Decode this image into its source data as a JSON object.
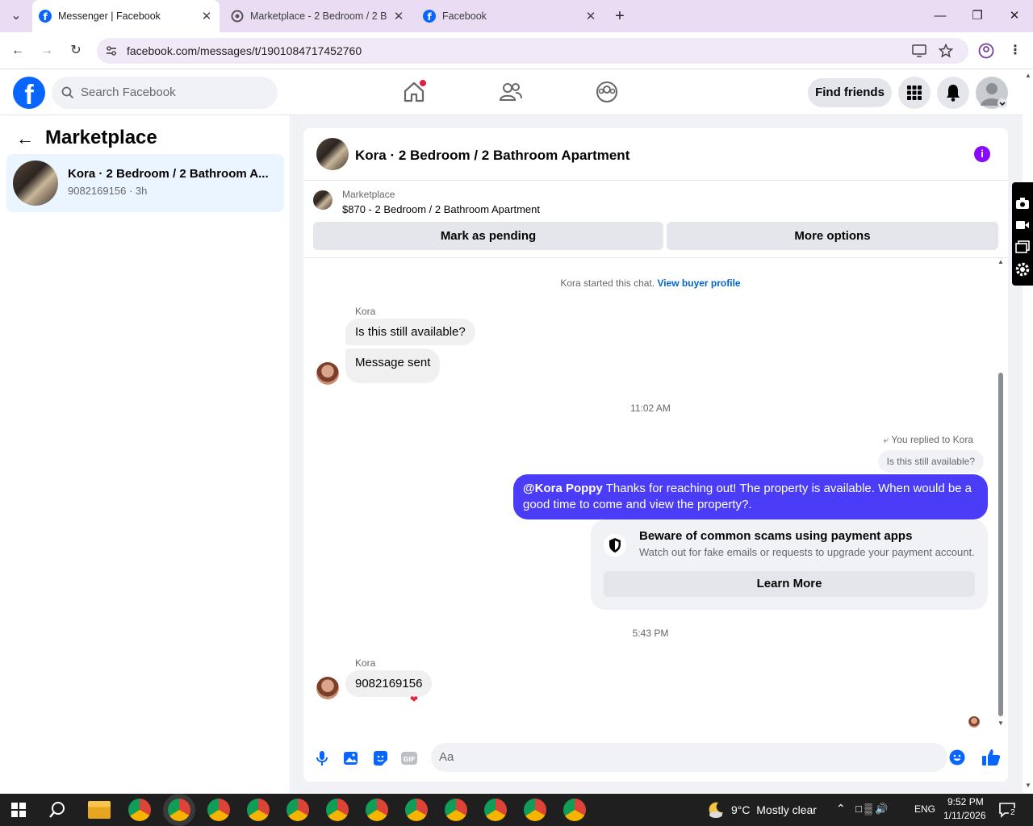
{
  "browser": {
    "tabs": [
      {
        "title": "Messenger | Facebook",
        "active": true
      },
      {
        "title": "Marketplace - 2 Bedroom / 2 B",
        "active": false
      },
      {
        "title": "Facebook",
        "active": false
      }
    ],
    "url": "facebook.com/messages/t/1901084717452760"
  },
  "fb_header": {
    "search_placeholder": "Search Facebook",
    "find_friends": "Find friends"
  },
  "left_panel": {
    "title": "Marketplace",
    "conversation": {
      "name": "Kora · 2 Bedroom / 2 Bathroom A...",
      "subtitle": "9082169156 · 3h"
    }
  },
  "chat": {
    "header_title": "Kora · 2 Bedroom / 2 Bathroom Apartment",
    "marketplace_label": "Marketplace",
    "listing": "$870 - 2 Bedroom / 2 Bathroom Apartment",
    "mark_pending": "Mark as pending",
    "more_options": "More options",
    "started_text": "Kora started this chat.",
    "view_buyer": "View buyer profile",
    "sender_name": "Kora",
    "msg1": "Is this still available?",
    "msg2": "Message sent",
    "time1": "11:02 AM",
    "replied_label": "You replied to Kora",
    "quoted": "Is this still available?",
    "reply_mention": "@Kora Poppy",
    "reply_text": " Thanks for reaching out! The property is available. When would be a good time to come and view the property?.",
    "scam_title": "Beware of common scams using payment apps",
    "scam_body": "Watch out for fake emails or requests to upgrade your payment account.",
    "learn_more": "Learn More",
    "time2": "5:43 PM",
    "msg3": "9082169156",
    "composer_placeholder": "Aa"
  },
  "taskbar": {
    "weather": "9°C  Mostly clear",
    "lang": "ENG",
    "time": "9:52 PM",
    "date": "1/11/2026",
    "notifications": "2"
  }
}
